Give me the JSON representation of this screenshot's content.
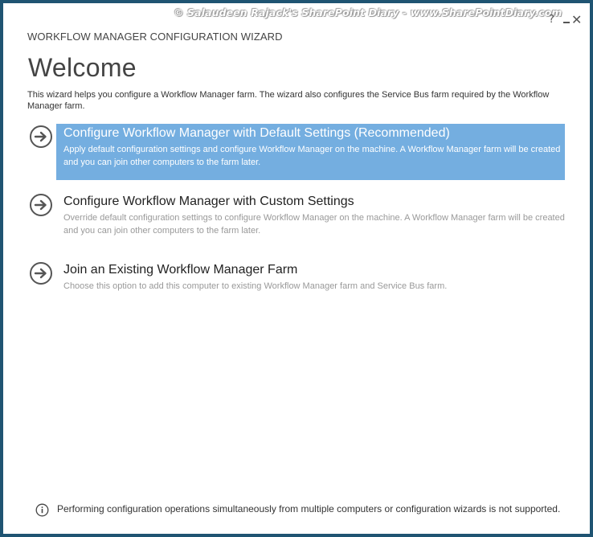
{
  "watermark": "© Salaudeen Rajack's SharePoint Diary - www.SharePointDiary.com",
  "window_controls": {
    "help": "?",
    "close": "✕"
  },
  "wizard_title": "WORKFLOW MANAGER CONFIGURATION WIZARD",
  "page_title": "Welcome",
  "intro": "This wizard helps you configure a Workflow Manager farm. The wizard also configures the Service Bus farm required by the Workflow Manager farm.",
  "options": [
    {
      "title": "Configure Workflow Manager with Default Settings (Recommended)",
      "description": "Apply default configuration settings and configure Workflow Manager on the machine. A Workflow Manager farm will be created and you can join other computers to the farm later.",
      "icon": "arrow-right-circle-icon",
      "selected": true
    },
    {
      "title": "Configure Workflow Manager with Custom Settings",
      "description": "Override default configuration settings to configure Workflow Manager on the machine. A Workflow Manager farm will be created and you can join other computers to the farm later.",
      "icon": "arrow-right-circle-icon",
      "selected": false
    },
    {
      "title": "Join an Existing Workflow Manager Farm",
      "description": "Choose this option to add this computer to existing Workflow Manager farm and Service Bus farm.",
      "icon": "arrow-right-circle-icon",
      "selected": false
    }
  ],
  "footer": {
    "icon": "info-icon",
    "note": "Performing configuration operations simultaneously from multiple computers or configuration wizards is not supported."
  },
  "colors": {
    "border": "#1f5472",
    "selected_background": "#74aee0",
    "description_text": "#999999",
    "heading_text": "#444444"
  }
}
